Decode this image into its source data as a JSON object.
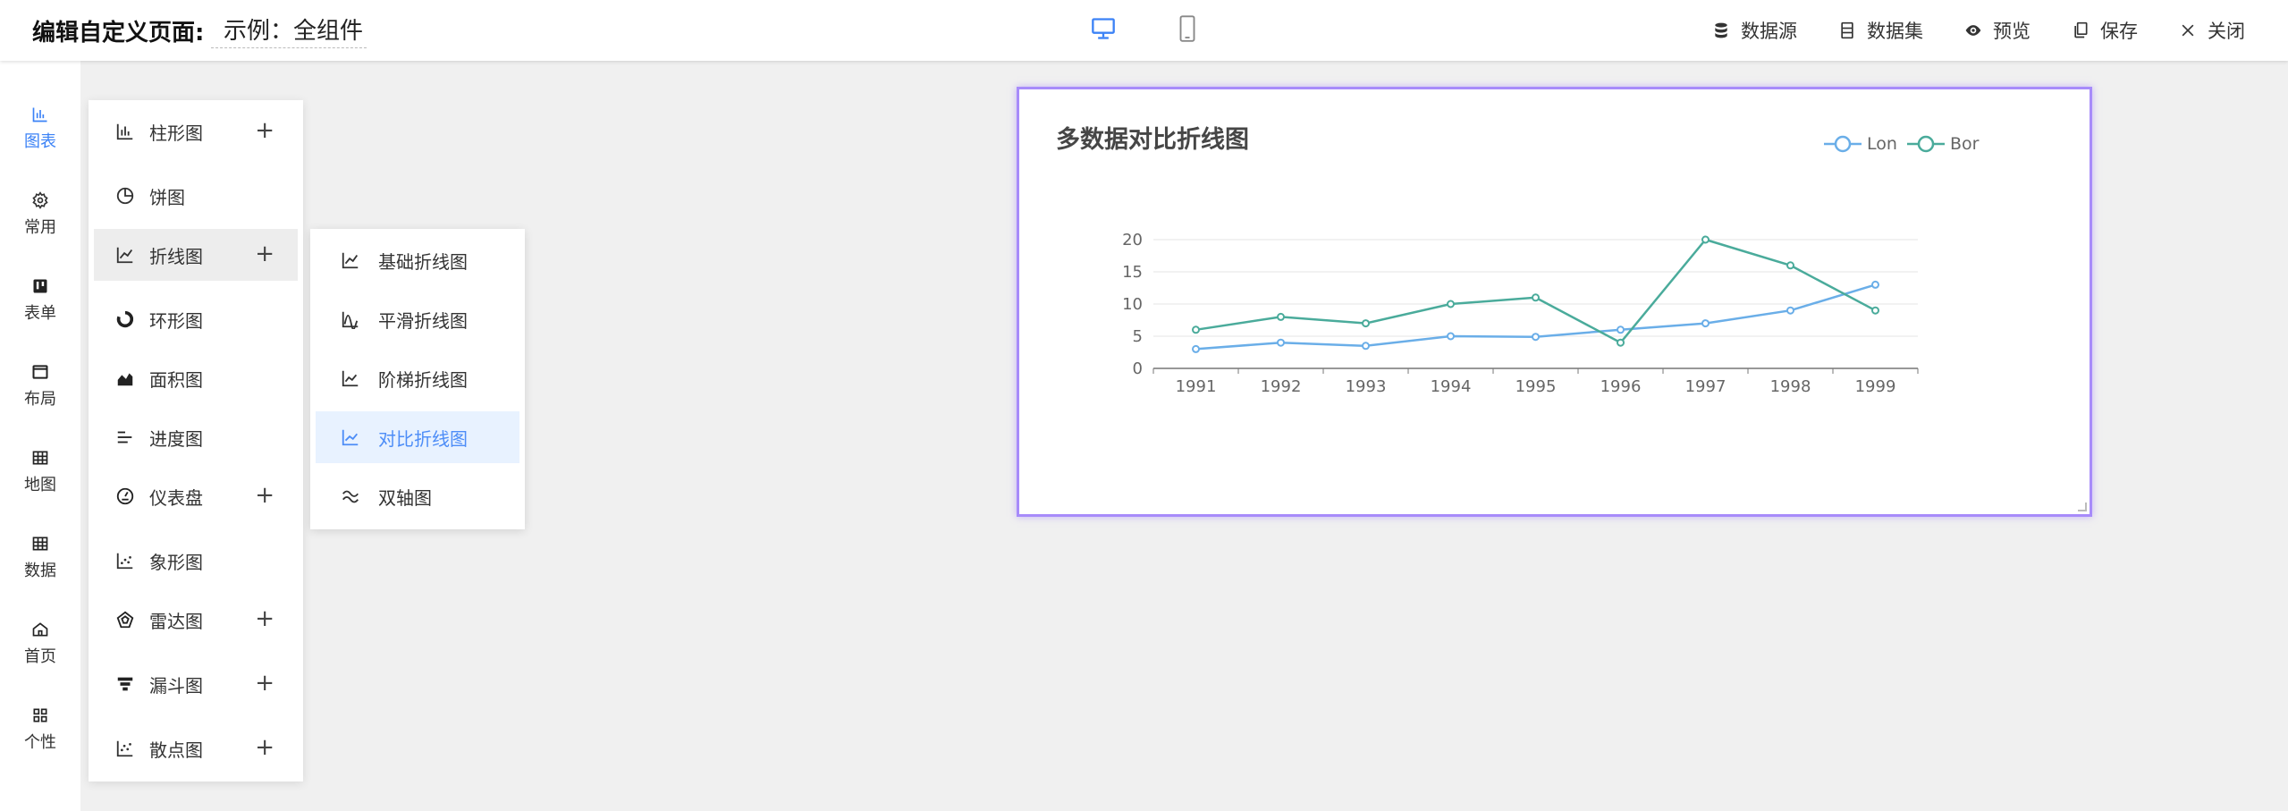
{
  "header": {
    "title": "编辑自定义页面:",
    "page_name": "示例：全组件",
    "actions": [
      {
        "label": "数据源",
        "icon": "database-icon"
      },
      {
        "label": "数据集",
        "icon": "dataset-icon"
      },
      {
        "label": "预览",
        "icon": "eye-icon"
      },
      {
        "label": "保存",
        "icon": "save-icon"
      },
      {
        "label": "关闭",
        "icon": "close-icon"
      }
    ],
    "devices": [
      {
        "name": "desktop",
        "icon": "desktop-icon",
        "active": true
      },
      {
        "name": "mobile",
        "icon": "mobile-icon",
        "active": false
      }
    ]
  },
  "rail": {
    "items": [
      {
        "label": "图表",
        "icon": "chart-icon",
        "active": true
      },
      {
        "label": "常用",
        "icon": "gear-icon"
      },
      {
        "label": "表单",
        "icon": "form-icon"
      },
      {
        "label": "布局",
        "icon": "layout-icon"
      },
      {
        "label": "地图",
        "icon": "map-grid-icon"
      },
      {
        "label": "数据",
        "icon": "table-icon"
      },
      {
        "label": "首页",
        "icon": "home-icon"
      },
      {
        "label": "个性",
        "icon": "apps-icon"
      }
    ]
  },
  "menu": {
    "items": [
      {
        "label": "柱形图",
        "icon": "bar-chart-icon",
        "expand": true
      },
      {
        "label": "饼图",
        "icon": "pie-chart-icon",
        "expand": false
      },
      {
        "label": "折线图",
        "icon": "line-chart-icon",
        "expand": true,
        "active": true
      },
      {
        "label": "环形图",
        "icon": "ring-chart-icon",
        "expand": false
      },
      {
        "label": "面积图",
        "icon": "area-chart-icon",
        "expand": false
      },
      {
        "label": "进度图",
        "icon": "progress-chart-icon",
        "expand": false
      },
      {
        "label": "仪表盘",
        "icon": "gauge-icon",
        "expand": true
      },
      {
        "label": "象形图",
        "icon": "pictorial-icon",
        "expand": false
      },
      {
        "label": "雷达图",
        "icon": "radar-icon",
        "expand": true
      },
      {
        "label": "漏斗图",
        "icon": "funnel-icon",
        "expand": true
      },
      {
        "label": "散点图",
        "icon": "scatter-icon",
        "expand": true
      }
    ],
    "plus": "+"
  },
  "submenu": {
    "items": [
      {
        "label": "基础折线图",
        "icon": "basic-line-icon"
      },
      {
        "label": "平滑折线图",
        "icon": "smooth-line-icon"
      },
      {
        "label": "阶梯折线图",
        "icon": "step-line-icon"
      },
      {
        "label": "对比折线图",
        "icon": "compare-line-icon",
        "active": true
      },
      {
        "label": "双轴图",
        "icon": "dual-axis-icon"
      }
    ]
  },
  "colors": {
    "accent": "#3b82f6",
    "card_border": "#a78bfa",
    "series_lon": "#6aaee8",
    "series_bor": "#4aab9b"
  },
  "chart_data": {
    "type": "line",
    "title": "多数据对比折线图",
    "x": [
      "1991",
      "1992",
      "1993",
      "1994",
      "1995",
      "1996",
      "1997",
      "1998",
      "1999"
    ],
    "ylim": [
      0,
      20
    ],
    "yticks": [
      0,
      5,
      10,
      15,
      20
    ],
    "grid": true,
    "legend_position": "top-right",
    "series": [
      {
        "name": "Lon",
        "color": "#6aaee8",
        "values": [
          3,
          4,
          3.5,
          5,
          4.9,
          6,
          7,
          9,
          13
        ]
      },
      {
        "name": "Bor",
        "color": "#4aab9b",
        "values": [
          6,
          8,
          7,
          10,
          11,
          4,
          20,
          16,
          9
        ]
      }
    ]
  }
}
